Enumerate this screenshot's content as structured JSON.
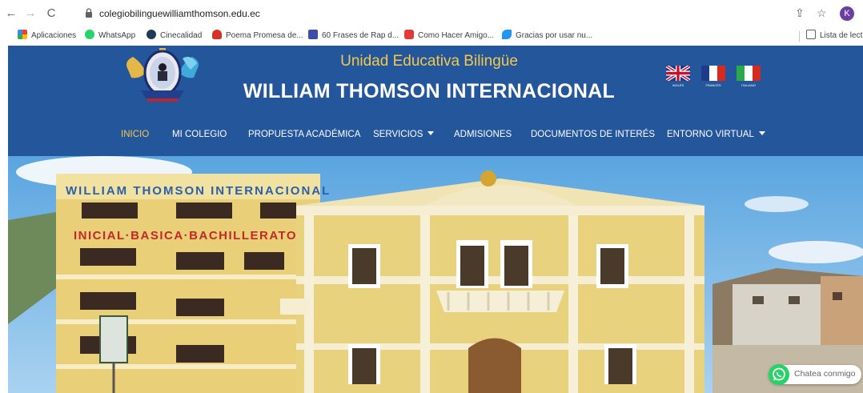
{
  "browser": {
    "url": "colegiobilinguewilliamthomson.edu.ec",
    "avatar_letter": "K",
    "bookmarks": [
      {
        "label": "Aplicaciones",
        "color": "#ea4335"
      },
      {
        "label": "WhatsApp",
        "color": "#25d366"
      },
      {
        "label": "Cinecalidad",
        "color": "#1f3b57"
      },
      {
        "label": "Poema Promesa de...",
        "color": "#d93025"
      },
      {
        "label": "60 Frases de Rap d...",
        "color": "#3b4ea8"
      },
      {
        "label": "Como Hacer Amigo...",
        "color": "#e53935"
      },
      {
        "label": "Gracias por usar nu...",
        "color": "#2196f3"
      }
    ],
    "reading_list": "Lista de lect"
  },
  "site": {
    "subtitle": "Unidad Educativa Bilingüe",
    "title": "WILLIAM THOMSON INTERNACIONAL",
    "flags": [
      {
        "label": "INGLÉS",
        "icon": "uk-flag-icon"
      },
      {
        "label": "FRANCÉS",
        "icon": "france-flag-icon"
      },
      {
        "label": "ITALIANO",
        "icon": "italy-flag-icon"
      }
    ],
    "menu": [
      {
        "label": "INICIO",
        "active": true
      },
      {
        "label": "MI COLEGIO"
      },
      {
        "label": "PROPUESTA ACADÉMICA"
      },
      {
        "label": "SERVICIOS",
        "dropdown": true
      },
      {
        "label": "ADMISIONES"
      },
      {
        "label": "DOCUMENTOS DE INTERÉS"
      },
      {
        "label": "ENTORNO VIRTUAL",
        "dropdown": true
      }
    ],
    "hero": {
      "building_sign": "WILLIAM THOMSON INTERNACIONAL",
      "levels_sign": "INICIAL·BASICA·BACHILLERATO"
    },
    "whatsapp_label": "Chatea conmigo"
  },
  "colors": {
    "header_blue": "#24569c",
    "accent_gold": "#f2c94c",
    "building_yellow": "#e8cf78"
  }
}
